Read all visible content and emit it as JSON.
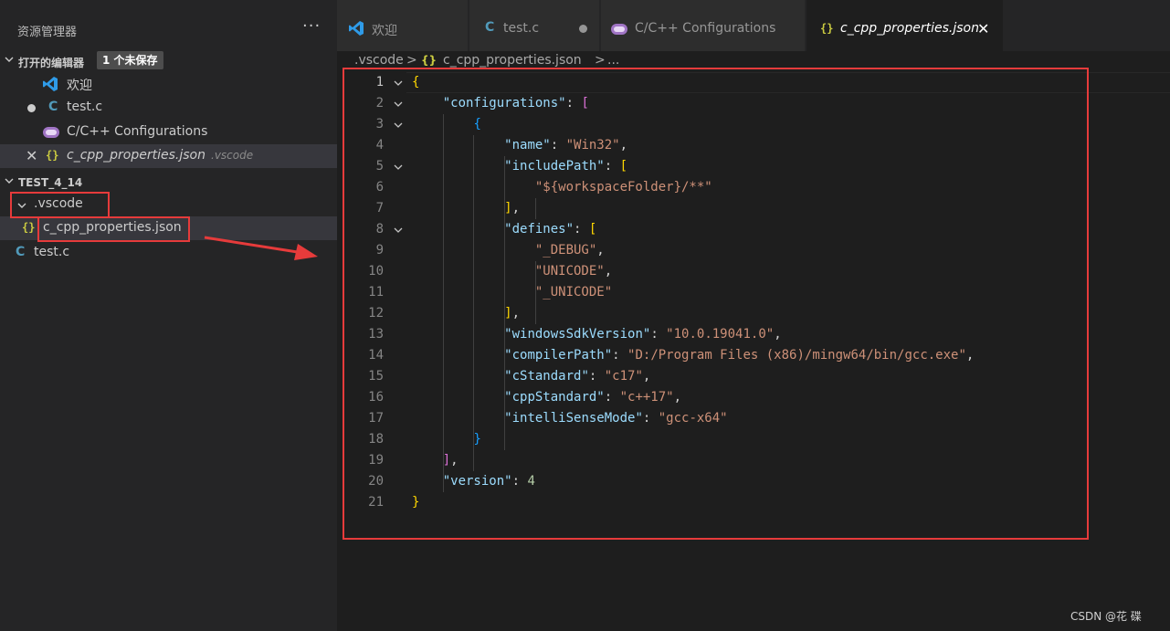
{
  "sidebar": {
    "title": "资源管理器",
    "more": "···",
    "open_editors": {
      "label": "打开的编辑器",
      "badge": "1 个未保存",
      "items": [
        {
          "label": "欢迎",
          "icon": "vscode-icon"
        },
        {
          "label": "test.c",
          "icon": "c-file-icon",
          "modified": true
        },
        {
          "label": "C/C++ Configurations",
          "icon": "cpp-config-icon"
        },
        {
          "label": "c_cpp_properties.json",
          "description": ".vscode",
          "icon": "json-icon",
          "active": true
        }
      ]
    },
    "workspace": {
      "label": "TEST_4_14",
      "folder": ".vscode",
      "folder_file": "c_cpp_properties.json",
      "file": "test.c"
    }
  },
  "tabs": [
    {
      "label": "欢迎",
      "icon": "vscode-icon"
    },
    {
      "label": "test.c",
      "icon": "c-file-icon",
      "modified": true
    },
    {
      "label": "C/C++ Configurations",
      "icon": "cpp-config-icon"
    },
    {
      "label": "c_cpp_properties.json",
      "icon": "json-icon",
      "active": true
    }
  ],
  "breadcrumb": {
    "folder": ".vscode",
    "sep": ">",
    "file": "c_cpp_properties.json",
    "more": "..."
  },
  "editor": {
    "current_line": 1,
    "lines": [
      [
        {
          "t": "{",
          "c": "b1"
        }
      ],
      [
        {
          "t": "    "
        },
        {
          "t": "\"configurations\"",
          "c": "k"
        },
        {
          "t": ": ",
          "c": "p"
        },
        {
          "t": "[",
          "c": "b2"
        }
      ],
      [
        {
          "t": "        "
        },
        {
          "t": "{",
          "c": "b3"
        }
      ],
      [
        {
          "t": "            "
        },
        {
          "t": "\"name\"",
          "c": "k"
        },
        {
          "t": ": ",
          "c": "p"
        },
        {
          "t": "\"Win32\"",
          "c": "s"
        },
        {
          "t": ",",
          "c": "p"
        }
      ],
      [
        {
          "t": "            "
        },
        {
          "t": "\"includePath\"",
          "c": "k"
        },
        {
          "t": ": ",
          "c": "p"
        },
        {
          "t": "[",
          "c": "b1"
        }
      ],
      [
        {
          "t": "                "
        },
        {
          "t": "\"${workspaceFolder}/**\"",
          "c": "s"
        }
      ],
      [
        {
          "t": "            "
        },
        {
          "t": "]",
          "c": "b1"
        },
        {
          "t": ",",
          "c": "p"
        }
      ],
      [
        {
          "t": "            "
        },
        {
          "t": "\"defines\"",
          "c": "k"
        },
        {
          "t": ": ",
          "c": "p"
        },
        {
          "t": "[",
          "c": "b1"
        }
      ],
      [
        {
          "t": "                "
        },
        {
          "t": "\"_DEBUG\"",
          "c": "s"
        },
        {
          "t": ",",
          "c": "p"
        }
      ],
      [
        {
          "t": "                "
        },
        {
          "t": "\"UNICODE\"",
          "c": "s"
        },
        {
          "t": ",",
          "c": "p"
        }
      ],
      [
        {
          "t": "                "
        },
        {
          "t": "\"_UNICODE\"",
          "c": "s"
        }
      ],
      [
        {
          "t": "            "
        },
        {
          "t": "]",
          "c": "b1"
        },
        {
          "t": ",",
          "c": "p"
        }
      ],
      [
        {
          "t": "            "
        },
        {
          "t": "\"windowsSdkVersion\"",
          "c": "k"
        },
        {
          "t": ": ",
          "c": "p"
        },
        {
          "t": "\"10.0.19041.0\"",
          "c": "s"
        },
        {
          "t": ",",
          "c": "p"
        }
      ],
      [
        {
          "t": "            "
        },
        {
          "t": "\"compilerPath\"",
          "c": "k"
        },
        {
          "t": ": ",
          "c": "p"
        },
        {
          "t": "\"D:/Program Files (x86)/mingw64/bin/gcc.exe\"",
          "c": "s"
        },
        {
          "t": ",",
          "c": "p"
        }
      ],
      [
        {
          "t": "            "
        },
        {
          "t": "\"cStandard\"",
          "c": "k"
        },
        {
          "t": ": ",
          "c": "p"
        },
        {
          "t": "\"c17\"",
          "c": "s"
        },
        {
          "t": ",",
          "c": "p"
        }
      ],
      [
        {
          "t": "            "
        },
        {
          "t": "\"cppStandard\"",
          "c": "k"
        },
        {
          "t": ": ",
          "c": "p"
        },
        {
          "t": "\"c++17\"",
          "c": "s"
        },
        {
          "t": ",",
          "c": "p"
        }
      ],
      [
        {
          "t": "            "
        },
        {
          "t": "\"intelliSenseMode\"",
          "c": "k"
        },
        {
          "t": ": ",
          "c": "p"
        },
        {
          "t": "\"gcc-x64\"",
          "c": "s"
        }
      ],
      [
        {
          "t": "        "
        },
        {
          "t": "}",
          "c": "b3"
        }
      ],
      [
        {
          "t": "    "
        },
        {
          "t": "]",
          "c": "b2"
        },
        {
          "t": ",",
          "c": "p"
        }
      ],
      [
        {
          "t": "    "
        },
        {
          "t": "\"version\"",
          "c": "k"
        },
        {
          "t": ": ",
          "c": "p"
        },
        {
          "t": "4",
          "c": "n"
        }
      ],
      [
        {
          "t": "}",
          "c": "b1"
        }
      ]
    ],
    "foldable_lines": [
      1,
      2,
      3,
      5,
      8
    ]
  },
  "watermark": "CSDN @花 碟",
  "colors": {
    "annotation_red": "#e63b3b",
    "json_key": "#9cdcfe",
    "json_string": "#ce9178",
    "json_number": "#b5cea8"
  }
}
